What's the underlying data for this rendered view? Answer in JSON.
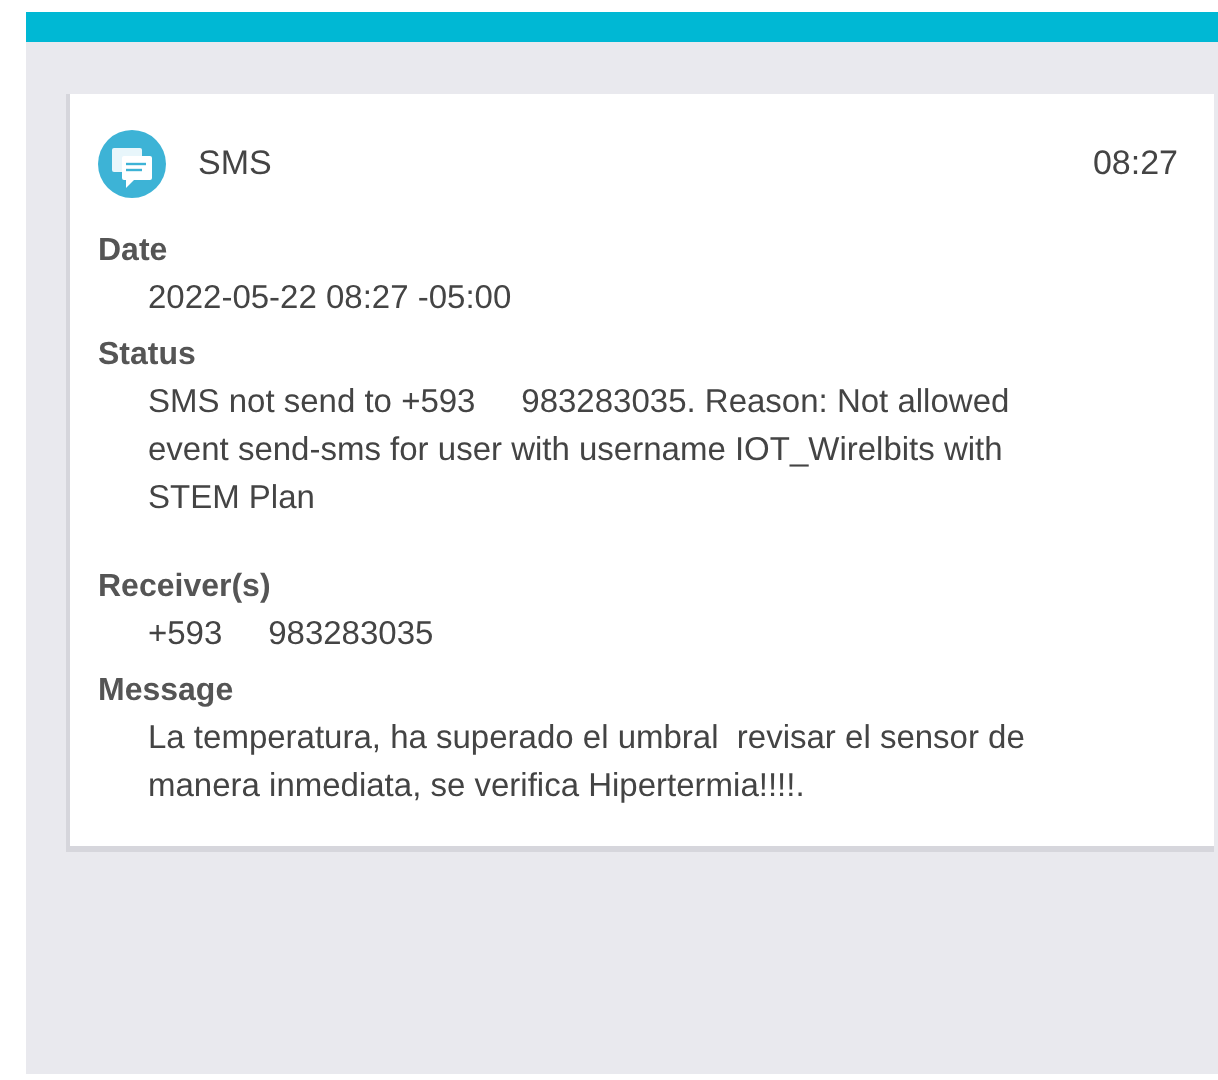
{
  "card": {
    "title": "SMS",
    "time": "08:27",
    "fields": [
      {
        "label": "Date",
        "value": "2022-05-22 08:27 -05:00"
      },
      {
        "label": "Status",
        "value": "SMS not send to +593     983283035. Reason: Not allowed event send-sms for user with username IOT_Wirelbits with STEM Plan"
      },
      {
        "label": "Receiver(s)",
        "value": "+593     983283035"
      },
      {
        "label": "Message",
        "value": "La temperatura, ha superado el umbral  revisar el sensor de manera inmediata, se verifica Hipertermia!!!!."
      }
    ]
  }
}
